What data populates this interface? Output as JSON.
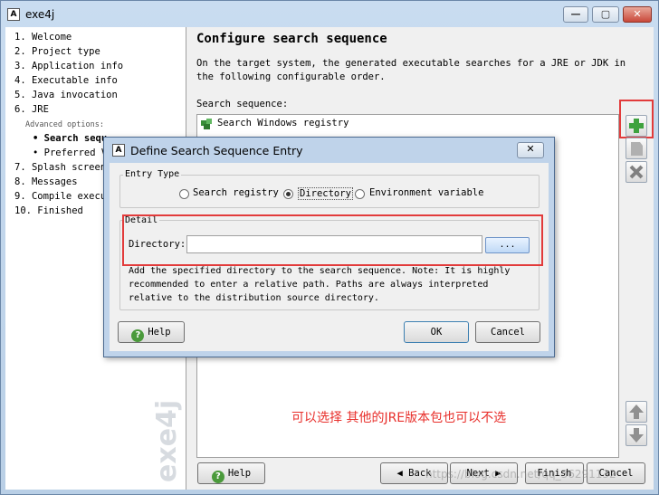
{
  "window": {
    "title": "exe4j",
    "app_icon": "A",
    "controls": [
      "—",
      "▢",
      "✕"
    ]
  },
  "steps": [
    {
      "label": "1.  Welcome"
    },
    {
      "label": "2.  Project type"
    },
    {
      "label": "3.  Application info"
    },
    {
      "label": "4.  Executable info"
    },
    {
      "label": "5.  Java invocation"
    },
    {
      "label": "6.  JRE"
    },
    {
      "label": "Advanced options:"
    },
    {
      "label": "• Search sequ"
    },
    {
      "label": "• Preferred VM"
    },
    {
      "label": "7.  Splash screen"
    },
    {
      "label": "8.  Messages"
    },
    {
      "label": "9.  Compile execu"
    },
    {
      "label": "10.  Finished"
    }
  ],
  "logo_text": "exe4j",
  "main": {
    "title": "Configure search sequence",
    "description": "On the target system, the generated executable searches for a JRE or JDK in the following configurable order.",
    "search_sequence_label": "Search sequence:",
    "entries": [
      "Search Windows registry"
    ],
    "note": "可以选择 其他的JRE版本包也可以不选"
  },
  "footer": {
    "help": "Help",
    "back": "Back",
    "next": "Next",
    "finish": "Finish",
    "cancel": "Cancel"
  },
  "watermark": "https://blog.csdn.net/qq_36291132",
  "dialog": {
    "title": "Define Search Sequence Entry",
    "close": "✕",
    "entry_type_label": "Entry Type",
    "options": [
      "Search registry",
      "Directory",
      "Environment variable"
    ],
    "selected": "Directory",
    "detail_label": "Detail",
    "directory_label": "Directory:",
    "directory_value": "",
    "browse": "...",
    "help_text": "Add the specified directory to the search sequence. Note: It is highly recommended to enter a relative path. Paths are always interpreted relative to the distribution source directory.",
    "help": "Help",
    "ok": "OK",
    "cancel": "Cancel"
  },
  "colors": {
    "annotation_red": "#e23b3b",
    "note_red": "#e8302c",
    "title_bar": "#c9dcf0"
  },
  "icons": [
    "add-icon",
    "edit-icon",
    "delete-icon",
    "move-up-icon",
    "move-down-icon",
    "help-icon",
    "registry-icon",
    "back-arrow-icon",
    "next-arrow-icon"
  ]
}
